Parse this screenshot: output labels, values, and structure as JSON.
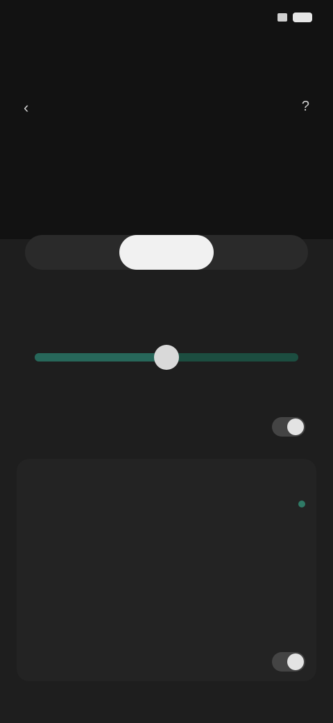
{
  "status_bar": {
    "time": "",
    "signal_icon": "signal-icon",
    "battery_icon": "battery-icon"
  },
  "header": {
    "title": "",
    "back_icon": "back-icon",
    "help_icon": "help-icon",
    "description": "",
    "link": "",
    "chip": ""
  },
  "mode_toggle": {
    "options": [
      "",
      "",
      ""
    ],
    "selected_index": 1
  },
  "slider_section": {
    "title": "",
    "min_label": "",
    "max_label": "",
    "value_fraction": 0.5
  },
  "settings": {
    "row1": {
      "label": "",
      "enabled": true
    },
    "row2": {
      "label": ""
    },
    "row3": {
      "label": ""
    },
    "row4": {
      "label": ""
    },
    "row5": {
      "label": ""
    },
    "row6": {
      "label": ""
    },
    "row7": {
      "label": "",
      "enabled": true
    }
  },
  "colors": {
    "accent": "#2f7a66",
    "background": "#1e1e1e"
  }
}
